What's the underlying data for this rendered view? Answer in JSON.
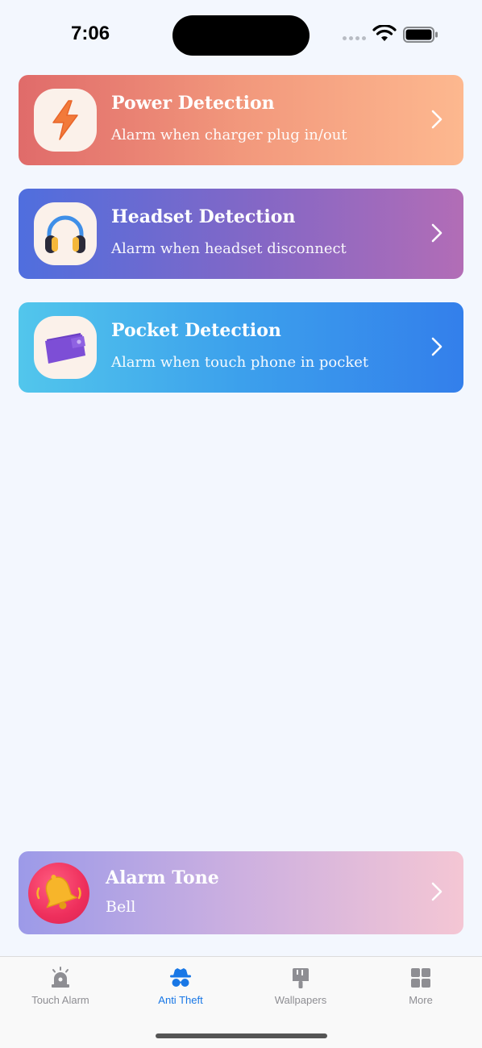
{
  "status_bar": {
    "time": "7:06"
  },
  "cards": [
    {
      "title": "Power Detection",
      "subtitle": "Alarm when charger plug in/out",
      "icon": "lightning-icon"
    },
    {
      "title": "Headset Detection",
      "subtitle": "Alarm when headset disconnect",
      "icon": "headphones-icon"
    },
    {
      "title": "Pocket Detection",
      "subtitle": "Alarm when touch phone in pocket",
      "icon": "wallet-icon"
    }
  ],
  "alarm_tone": {
    "title": "Alarm Tone",
    "value": "Bell",
    "icon": "bell-icon"
  },
  "tabs": [
    {
      "label": "Touch Alarm",
      "icon": "siren-icon",
      "active": false
    },
    {
      "label": "Anti Theft",
      "icon": "spy-icon",
      "active": true
    },
    {
      "label": "Wallpapers",
      "icon": "paint-brush-icon",
      "active": false
    },
    {
      "label": "More",
      "icon": "grid-icon",
      "active": false
    }
  ],
  "colors": {
    "accent": "#1877e6",
    "inactive_tab": "#8e8e93",
    "background": "#f3f7fe"
  }
}
